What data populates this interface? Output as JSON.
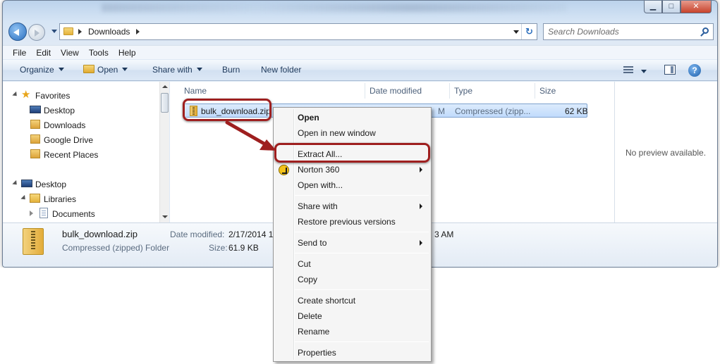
{
  "window": {
    "caption_buttons": {
      "minimize": "▁",
      "maximize": "□",
      "close": "✕"
    }
  },
  "address": {
    "location": "Downloads",
    "refresh_glyph": "↻"
  },
  "search": {
    "placeholder": "Search Downloads"
  },
  "menu_bar": [
    "File",
    "Edit",
    "View",
    "Tools",
    "Help"
  ],
  "command_bar": {
    "organize": "Organize",
    "open": "Open",
    "share_with": "Share with",
    "burn": "Burn",
    "new_folder": "New folder",
    "help": "?"
  },
  "nav_tree": {
    "favorites": "Favorites",
    "favorite_items": [
      "Desktop",
      "Downloads",
      "Google Drive",
      "Recent Places"
    ],
    "desktop": "Desktop",
    "libraries": "Libraries",
    "documents": "Documents"
  },
  "columns": {
    "name": "Name",
    "date_modified": "Date modified",
    "type": "Type",
    "size": "Size"
  },
  "file": {
    "name": "bulk_download.zip",
    "date_fragment": "M",
    "type": "Compressed (zipp...",
    "size": "62 KB"
  },
  "preview": {
    "message": "No preview available."
  },
  "details": {
    "name": "bulk_download.zip",
    "kind": "Compressed (zipped) Folder",
    "date_label": "Date modified:",
    "date_value": "2/17/2014 1",
    "time_fragment": "3 AM",
    "size_label": "Size:",
    "size_value": "61.9 KB"
  },
  "context_menu": {
    "open": "Open",
    "open_new_window": "Open in new window",
    "extract_all": "Extract All...",
    "norton": "Norton 360",
    "open_with": "Open with...",
    "share_with": "Share with",
    "restore": "Restore previous versions",
    "send_to": "Send to",
    "cut": "Cut",
    "copy": "Copy",
    "create_shortcut": "Create shortcut",
    "delete": "Delete",
    "rename": "Rename",
    "properties": "Properties"
  },
  "colors": {
    "annotation": "#9e1f1f",
    "selection": "#c1dbfc",
    "accent": "#1e395b"
  },
  "icons": [
    "back-arrow-icon",
    "forward-arrow-icon",
    "folder-icon",
    "refresh-icon",
    "search-icon",
    "star-icon",
    "desktop-icon",
    "zip-folder-icon",
    "norton-icon",
    "help-icon",
    "view-icon",
    "preview-pane-icon"
  ]
}
